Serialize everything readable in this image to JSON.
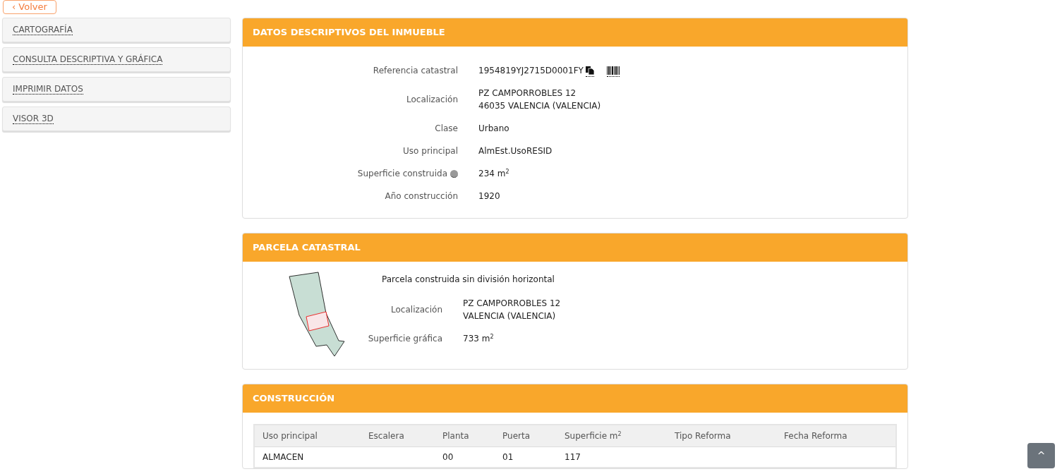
{
  "back_button": {
    "icon": "‹",
    "label": "Volver"
  },
  "sidebar": {
    "items": [
      {
        "label": "CARTOGRAFÍA"
      },
      {
        "label": "CONSULTA DESCRIPTIVA Y GRÁFICA"
      },
      {
        "label": "IMPRIMIR DATOS"
      },
      {
        "label": "VISOR 3D"
      }
    ]
  },
  "datos": {
    "title": "DATOS DESCRIPTIVOS DEL INMUEBLE",
    "rows": [
      {
        "kind": "ref",
        "label": "Referencia catastral",
        "lines": [
          "1954819YJ2715D0001FY"
        ]
      },
      {
        "kind": "plain",
        "label": "Localización",
        "lines": [
          "PZ CAMPORROBLES 12",
          "46035 VALENCIA (VALENCIA)"
        ]
      },
      {
        "kind": "plain",
        "label": "Clase",
        "lines": [
          "Urbano"
        ]
      },
      {
        "kind": "plain",
        "label": "Uso principal",
        "lines": [
          "AlmEst.UsoRESID"
        ]
      },
      {
        "kind": "info",
        "label": "Superficie construida",
        "lines": [
          "234 m$^{2}$"
        ]
      },
      {
        "kind": "plain",
        "label": "Año construcción",
        "lines": [
          "1920"
        ]
      }
    ]
  },
  "parcela": {
    "title": "PARCELA CATASTRAL",
    "description": "Parcela construida sin división horizontal",
    "rows": [
      {
        "label": "Localización",
        "lines": [
          "PZ CAMPORROBLES 12",
          "VALENCIA (VALENCIA)"
        ]
      },
      {
        "label": "Superficie gráfica",
        "lines": [
          "733 m$^{2}$"
        ]
      }
    ]
  },
  "construccion": {
    "title": "CONSTRUCCIÓN",
    "table": {
      "columns": [
        "Uso principal",
        "Escalera",
        "Planta",
        "Puerta",
        "Superficie m$^{2}$",
        "Tipo Reforma",
        "Fecha Reforma"
      ],
      "rows": [
        [
          "ALMACEN",
          "",
          "00",
          "01",
          "117",
          "",
          ""
        ]
      ]
    }
  },
  "scroll_top": {
    "icon": "^"
  }
}
